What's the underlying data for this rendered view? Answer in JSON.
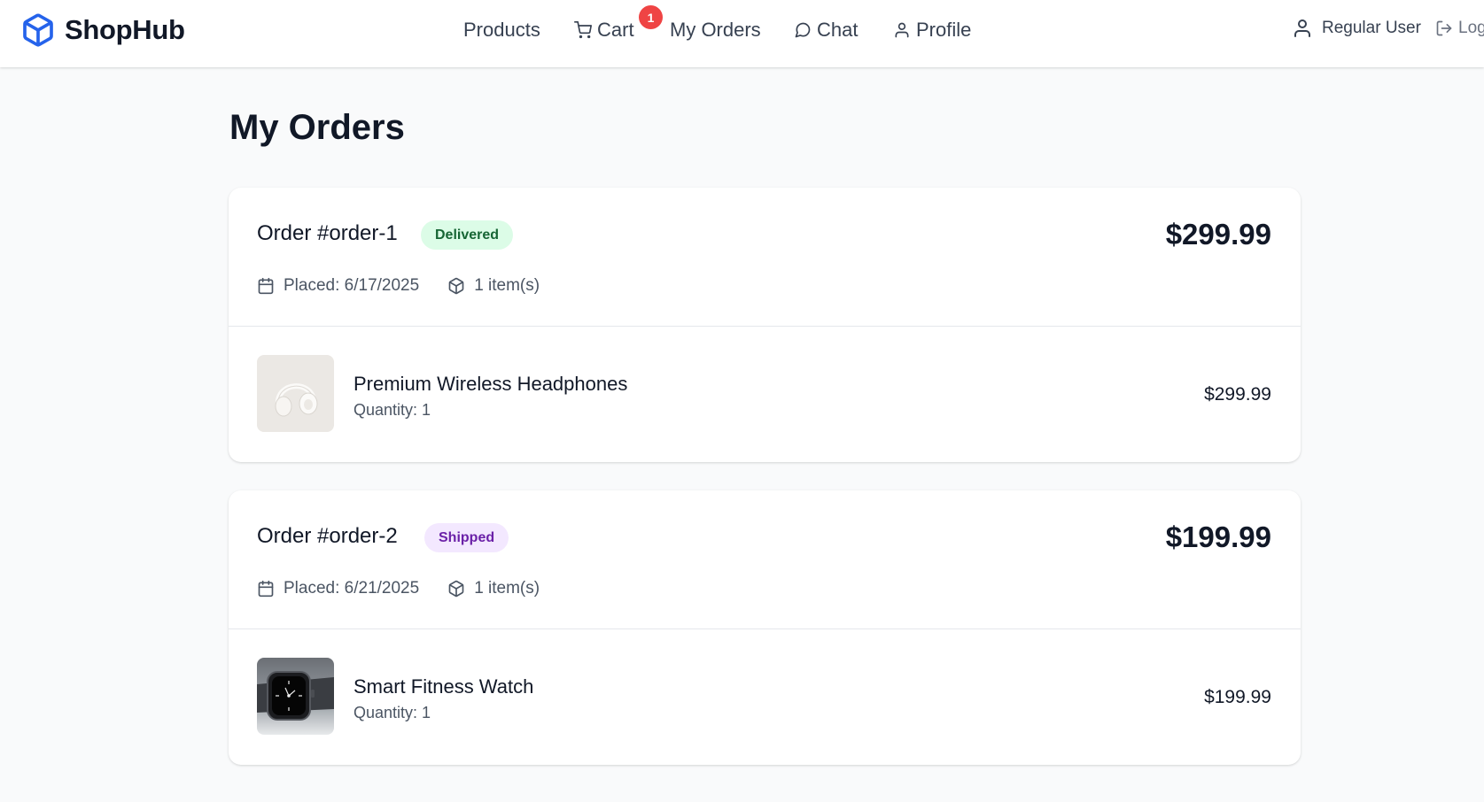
{
  "app": {
    "brand": "ShopHub",
    "accent_color": "#2563eb",
    "badge_color": "#ef4444"
  },
  "nav": {
    "products": "Products",
    "cart": "Cart",
    "cart_count": "1",
    "my_orders": "My Orders",
    "chat": "Chat",
    "profile": "Profile"
  },
  "user": {
    "name": "Regular User",
    "logout": "Logout"
  },
  "page": {
    "title": "My Orders"
  },
  "orders": [
    {
      "id": "Order #order-1",
      "status": "Delivered",
      "total": "$299.99",
      "placed": "Placed: 6/17/2025",
      "item_count": "1 item(s)",
      "items": [
        {
          "name": "Premium Wireless Headphones",
          "quantity": "Quantity: 1",
          "price": "$299.99",
          "image": "white-headphones-photo"
        }
      ]
    },
    {
      "id": "Order #order-2",
      "status": "Shipped",
      "total": "$199.99",
      "placed": "Placed: 6/21/2025",
      "item_count": "1 item(s)",
      "items": [
        {
          "name": "Smart Fitness Watch",
          "quantity": "Quantity: 1",
          "price": "$199.99",
          "image": "smartwatch-photo"
        }
      ]
    }
  ],
  "icons": {
    "logo": "package-cube-icon",
    "cart": "shopping-cart-icon",
    "chat": "message-circle-icon",
    "profile": "user-icon",
    "logout": "log-out-icon",
    "calendar": "calendar-icon",
    "package": "package-icon"
  }
}
